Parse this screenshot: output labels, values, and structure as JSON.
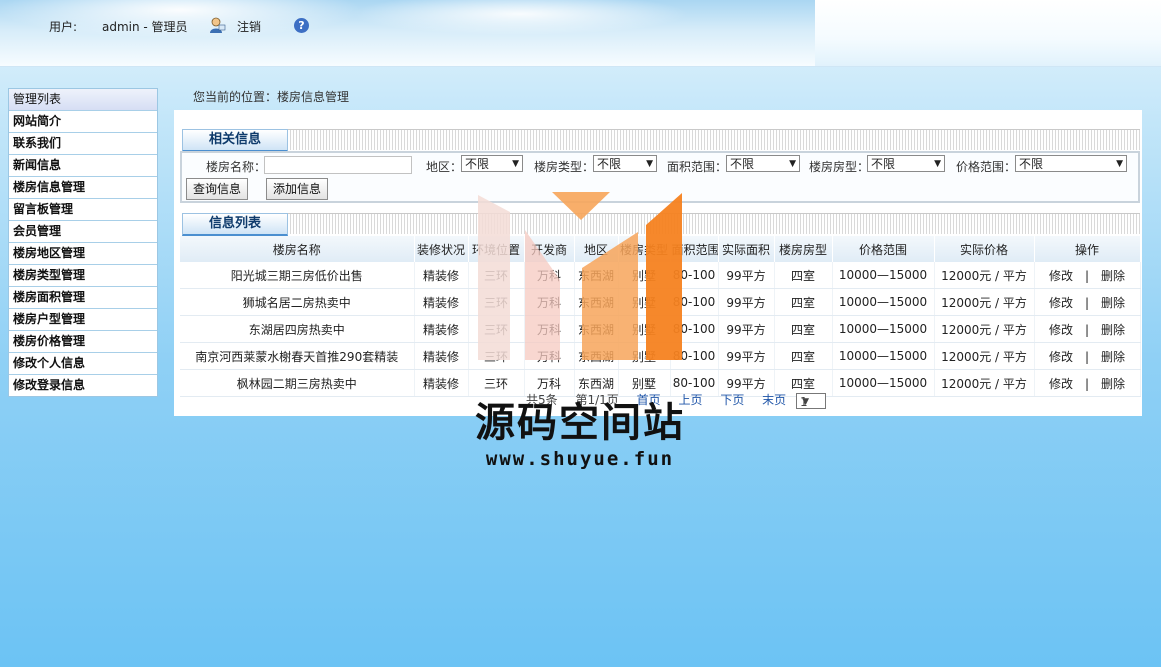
{
  "header": {
    "user_label": "用户:",
    "user_name": "admin - 管理员",
    "logout_label": "注销",
    "help_glyph": "?"
  },
  "sidebar": {
    "items": [
      {
        "label": "管理列表"
      },
      {
        "label": "网站简介"
      },
      {
        "label": "联系我们"
      },
      {
        "label": "新闻信息"
      },
      {
        "label": "楼房信息管理"
      },
      {
        "label": "留言板管理"
      },
      {
        "label": "会员管理"
      },
      {
        "label": "楼房地区管理"
      },
      {
        "label": "楼房类型管理"
      },
      {
        "label": "楼房面积管理"
      },
      {
        "label": "楼房户型管理"
      },
      {
        "label": "楼房价格管理"
      },
      {
        "label": "修改个人信息"
      },
      {
        "label": "修改登录信息"
      }
    ]
  },
  "breadcrumb": "您当前的位置：楼房信息管理",
  "search_panel": {
    "title": "相关信息",
    "name_label": "楼房名称：",
    "name_value": "",
    "filters": [
      {
        "label": "地区：",
        "value": "不限"
      },
      {
        "label": "楼房类型：",
        "value": "不限"
      },
      {
        "label": "面积范围：",
        "value": "不限"
      },
      {
        "label": "楼房房型：",
        "value": "不限"
      },
      {
        "label": "价格范围：",
        "value": "不限"
      }
    ],
    "query_button": "查询信息",
    "add_button": "添加信息"
  },
  "list_panel": {
    "title": "信息列表",
    "columns": [
      "楼房名称",
      "装修状况",
      "环境位置",
      "开发商",
      "地区",
      "楼房类型",
      "面积范围",
      "实际面积",
      "楼房房型",
      "价格范围",
      "实际价格",
      "操作"
    ],
    "rows": [
      [
        "阳光城三期三房低价出售",
        "精装修",
        "三环",
        "万科",
        "东西湖",
        "别墅",
        "80-100",
        "99平方",
        "四室",
        "10000—15000",
        "12000元 / 平方"
      ],
      [
        "狮城名居二房热卖中",
        "精装修",
        "三环",
        "万科",
        "东西湖",
        "别墅",
        "80-100",
        "99平方",
        "四室",
        "10000—15000",
        "12000元 / 平方"
      ],
      [
        "东湖居四房热卖中",
        "精装修",
        "三环",
        "万科",
        "东西湖",
        "别墅",
        "80-100",
        "99平方",
        "四室",
        "10000—15000",
        "12000元 / 平方"
      ],
      [
        "南京河西莱蒙水榭春天首推290套精装",
        "精装修",
        "三环",
        "万科",
        "东西湖",
        "别墅",
        "80-100",
        "99平方",
        "四室",
        "10000—15000",
        "12000元 / 平方"
      ],
      [
        "枫林园二期三房热卖中",
        "精装修",
        "三环",
        "万科",
        "东西湖",
        "别墅",
        "80-100",
        "99平方",
        "四室",
        "10000—15000",
        "12000元 / 平方"
      ]
    ],
    "edit_label": "修改",
    "delete_label": "删除",
    "op_separator": "|",
    "pager": {
      "total": "共5条",
      "page_info": "第1/1页",
      "first": "首页",
      "prev": "上页",
      "next": "下页",
      "last": "末页",
      "current_page": "1"
    }
  },
  "watermark": {
    "title": "源码空间站",
    "url": "www.shuyue.fun",
    "colors": [
      "#f5c9c0",
      "#f7a55a",
      "#f58220",
      "#f3dcd6"
    ]
  }
}
